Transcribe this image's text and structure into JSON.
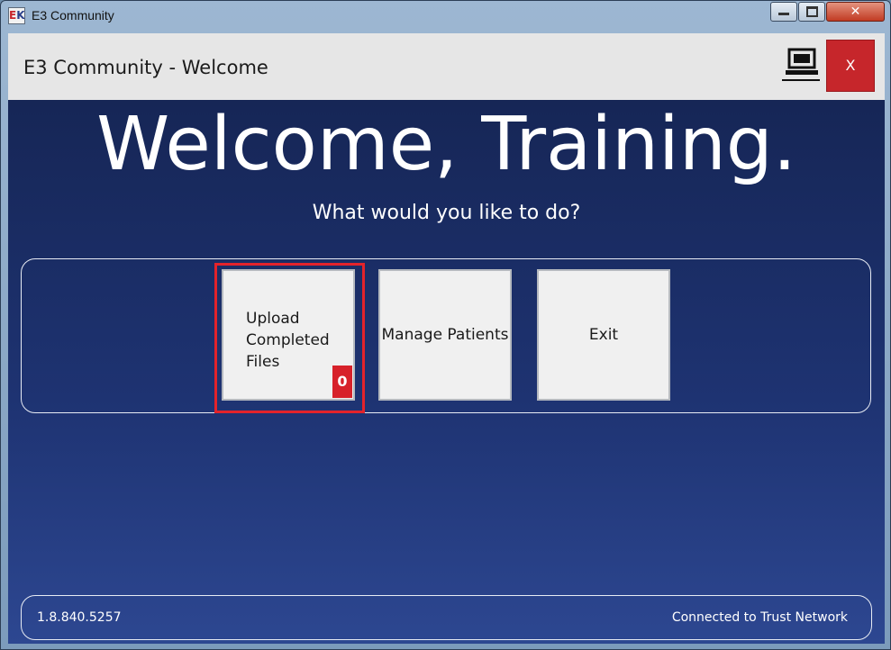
{
  "window": {
    "title": "E3 Community",
    "icon": "e3-logo-icon",
    "close_glyph": "✕"
  },
  "header": {
    "title": "E3 Community - Welcome",
    "status_icon": "computer-icon",
    "close_label": "X"
  },
  "main": {
    "greeting": "Welcome, Training.",
    "prompt": "What would you like to do?",
    "actions": [
      {
        "label_lines": [
          "Upload",
          "Completed",
          "Files"
        ],
        "badge": "0"
      },
      {
        "label": "Manage Patients"
      },
      {
        "label": "Exit"
      }
    ]
  },
  "status": {
    "version": "1.8.840.5257",
    "connection": "Connected to Trust Network"
  },
  "colors": {
    "accent_red": "#c6262b",
    "background_dark": "#162656",
    "background_light": "#2d4791",
    "highlight": "#e3232b"
  }
}
